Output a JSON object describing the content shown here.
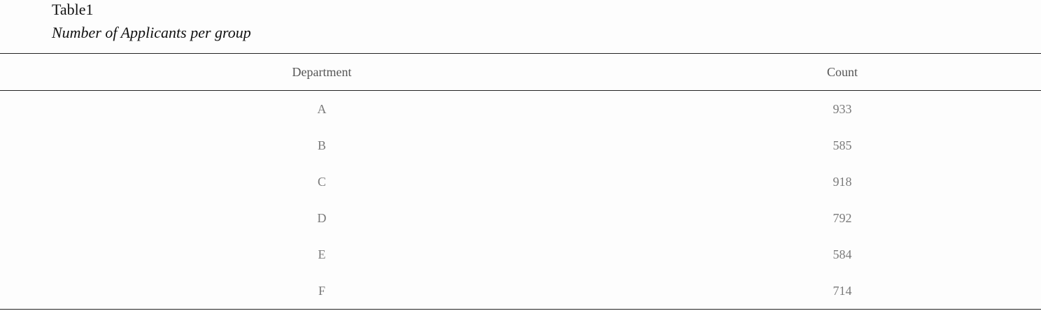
{
  "table": {
    "title": "Table1",
    "subtitle": "Number of Applicants per group",
    "columns": [
      "Department",
      "Count"
    ],
    "rows": [
      [
        "A",
        "933"
      ],
      [
        "B",
        "585"
      ],
      [
        "C",
        "918"
      ],
      [
        "D",
        "792"
      ],
      [
        "E",
        "584"
      ],
      [
        "F",
        "714"
      ]
    ]
  }
}
